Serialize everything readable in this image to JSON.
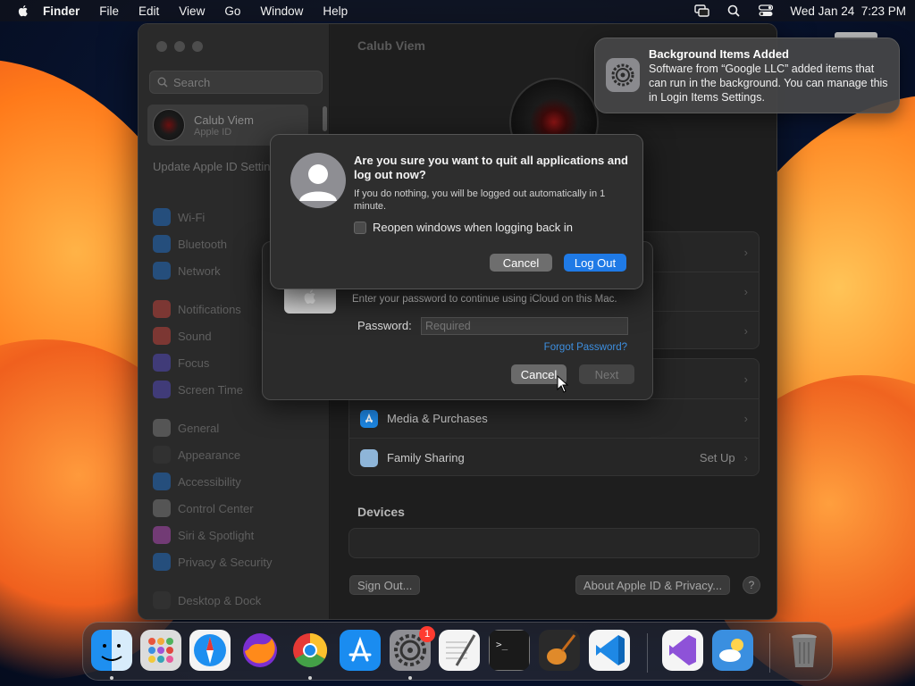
{
  "menubar": {
    "app": "Finder",
    "items": [
      "File",
      "Edit",
      "View",
      "Go",
      "Window",
      "Help"
    ],
    "datetime": "Wed Jan 24  7:23 PM"
  },
  "sidebar": {
    "search_placeholder": "Search",
    "user_name": "Calub Viem",
    "user_sub": "Apple ID",
    "update_notice": "Update Apple ID Settings",
    "items": [
      {
        "label": "Wi-Fi",
        "color": "#1e7ae0"
      },
      {
        "label": "Bluetooth",
        "color": "#1e7ae0"
      },
      {
        "label": "Network",
        "color": "#1e7ae0"
      },
      {
        "label": "Notifications",
        "color": "#e0463e"
      },
      {
        "label": "Sound",
        "color": "#e0463e"
      },
      {
        "label": "Focus",
        "color": "#5a4fd6"
      },
      {
        "label": "Screen Time",
        "color": "#5a4fd6"
      },
      {
        "label": "General",
        "color": "#8a8a8a"
      },
      {
        "label": "Appearance",
        "color": "#3a3a3a"
      },
      {
        "label": "Accessibility",
        "color": "#1e7ae0"
      },
      {
        "label": "Control Center",
        "color": "#8a8a8a"
      },
      {
        "label": "Siri & Spotlight",
        "color": "#c94fd0"
      },
      {
        "label": "Privacy & Security",
        "color": "#1e7ae0"
      },
      {
        "label": "Desktop & Dock",
        "color": "#3a3a3a"
      }
    ]
  },
  "content": {
    "title": "Calub Viem",
    "rows": [
      {
        "label": "Media & Purchases",
        "value": "",
        "color": "#1e88e5"
      },
      {
        "label": "Family Sharing",
        "value": "Set Up",
        "color": "#8eb5d8"
      }
    ],
    "devices_label": "Devices",
    "sign_out": "Sign Out...",
    "about": "About Apple ID & Privacy...",
    "help": "?"
  },
  "password_dialog": {
    "message": "Enter your password to continue using iCloud on this Mac.",
    "password_label": "Password:",
    "password_placeholder": "Required",
    "forgot": "Forgot Password?",
    "cancel": "Cancel",
    "next": "Next"
  },
  "logout_dialog": {
    "title": "Are you sure you want to quit all applications and log out now?",
    "info": "If you do nothing, you will be logged out automatically in 1 minute.",
    "checkbox_label": "Reopen windows when logging back in",
    "cancel": "Cancel",
    "confirm": "Log Out"
  },
  "notification": {
    "title": "Background Items Added",
    "body": "Software from “Google LLC” added items that can run in the background. You can manage this in Login Items Settings."
  },
  "dock": {
    "settings_badge": "1",
    "apps": [
      {
        "name": "finder",
        "color": "#1e8ff0",
        "running": true
      },
      {
        "name": "launchpad",
        "color": "#d9d9d9",
        "running": false
      },
      {
        "name": "safari",
        "color": "#f0f0f0",
        "running": false
      },
      {
        "name": "firefox",
        "color": "#ff7a1a",
        "running": false
      },
      {
        "name": "chrome",
        "color": "#f2f2f2",
        "running": true
      },
      {
        "name": "app-store",
        "color": "#1a8cf0",
        "running": false
      },
      {
        "name": "system-settings",
        "color": "#8e8e93",
        "running": true
      },
      {
        "name": "textedit",
        "color": "#f4f4f4",
        "running": false
      },
      {
        "name": "terminal",
        "color": "#1a1a1a",
        "running": false
      },
      {
        "name": "garageband",
        "color": "#2a2a2a",
        "running": false
      },
      {
        "name": "vscode",
        "color": "#f5f5f5",
        "running": false
      },
      {
        "name": "visual-studio",
        "color": "#f5f5f5",
        "running": false
      },
      {
        "name": "weather",
        "color": "#3a8fe0",
        "running": false
      },
      {
        "name": "trash",
        "color": "#6a6a6a",
        "running": false
      }
    ]
  }
}
